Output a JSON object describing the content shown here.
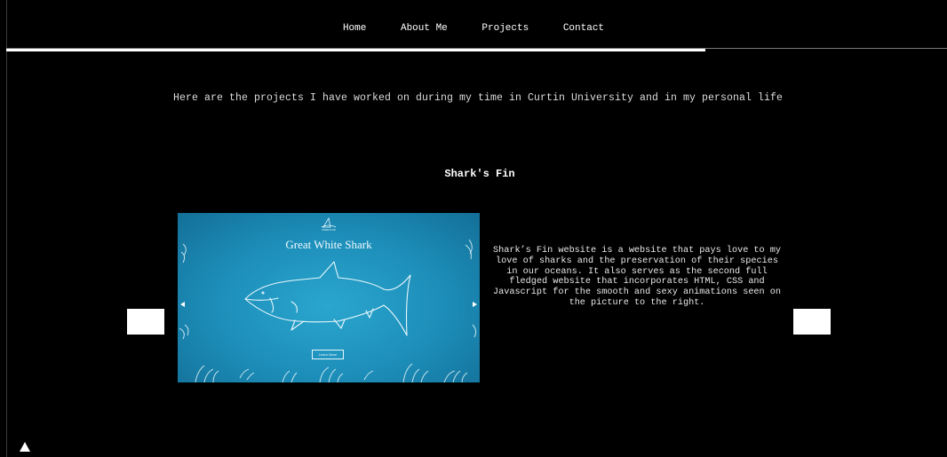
{
  "nav": {
    "items": [
      {
        "label": "Home"
      },
      {
        "label": "About Me"
      },
      {
        "label": "Projects"
      },
      {
        "label": "Contact"
      }
    ]
  },
  "intro": {
    "text": "Here are the projects I have worked on during my time in Curtin University and in my personal life"
  },
  "project": {
    "title": "Shark's Fin",
    "screenshot": {
      "heading": "Great White Shark",
      "button_label": "Learn More",
      "logo_label": "SHARK'S FIN",
      "colors": {
        "ocean_light": "#2aa6cf",
        "ocean_dark": "#136f97",
        "line": "#e9f7fb"
      }
    },
    "description": "Shark’s Fin website is a website that pays love to my love of sharks and the preservation of their species in our oceans. It also serves as the second full fledged website that incorporates HTML, CSS and Javascript for the smooth and sexy animations seen on the picture to the right."
  },
  "icons": {
    "scroll_top": "triangle-up-icon"
  }
}
